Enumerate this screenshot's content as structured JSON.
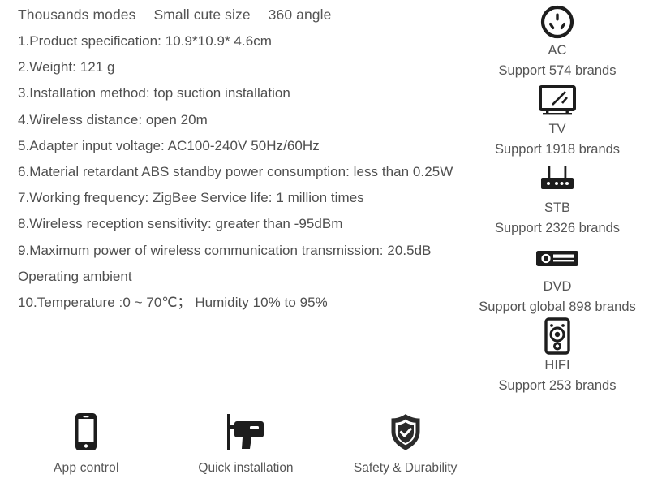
{
  "headline": {
    "segments": [
      "Thousands modes",
      "Small cute size",
      "360 angle"
    ]
  },
  "specs": [
    "1.Product specification: 10.9*10.9* 4.6cm",
    "2.Weight: 121 g",
    "3.Installation method: top suction installation",
    "4.Wireless distance: open 20m",
    "5.Adapter input voltage: AC100-240V 50Hz/60Hz",
    "6.Material retardant ABS standby power consumption: less than 0.25W",
    "7.Working frequency: ZigBee Service life: 1 million times",
    "8.Wireless reception sensitivity: greater than -95dBm",
    "9.Maximum power of wireless communication transmission: 20.5dB",
    "Operating ambient",
    "10.Temperature :0 ~ 70℃； Humidity 10% to 95%"
  ],
  "devices": [
    {
      "icon": "ac-socket-icon",
      "name": "AC",
      "support": "Support 574 brands"
    },
    {
      "icon": "tv-icon",
      "name": "TV",
      "support": "Support 1918 brands"
    },
    {
      "icon": "stb-router-icon",
      "name": "STB",
      "support": "Support 2326 brands"
    },
    {
      "icon": "dvd-player-icon",
      "name": "DVD",
      "support": "Support global 898 brands"
    },
    {
      "icon": "hifi-speaker-icon",
      "name": "HIFI",
      "support": "Support 253 brands"
    }
  ],
  "features": [
    {
      "icon": "smartphone-icon",
      "label": "App  control"
    },
    {
      "icon": "drill-icon",
      "label": "Quick installation"
    },
    {
      "icon": "shield-check-icon",
      "label": "Safety & Durability"
    }
  ],
  "colors": {
    "text": "#4f4f4f",
    "icon": "#1d1d1d",
    "background": "#ffffff"
  }
}
